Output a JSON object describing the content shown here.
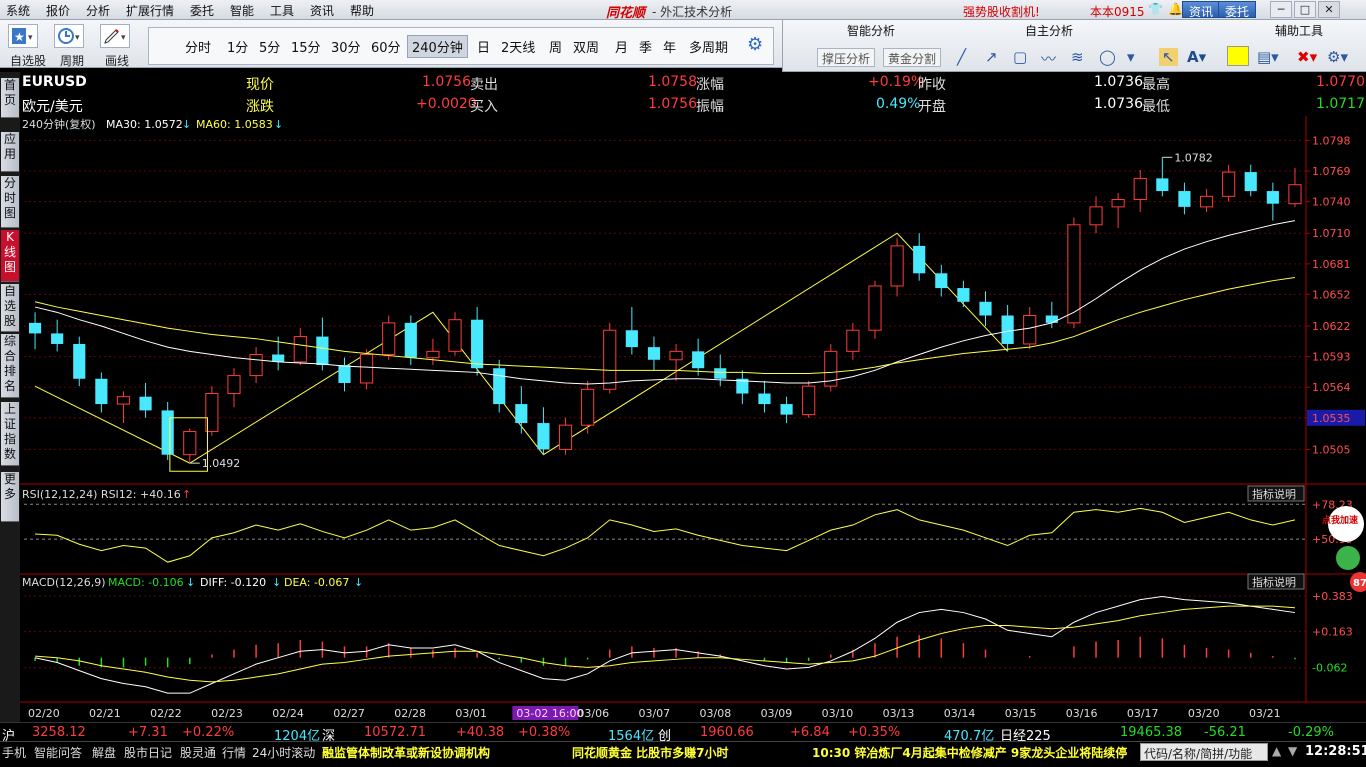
{
  "menu": [
    "系统",
    "报价",
    "分析",
    "扩展行情",
    "委托",
    "智能",
    "工具",
    "资讯",
    "帮助"
  ],
  "logo": "同花顺",
  "app_title": "- 外汇技术分析",
  "notice": "强势股收割机!",
  "user": "本本0915",
  "header_buttons": {
    "news": "资讯",
    "trade": "委托"
  },
  "toolbar": {
    "self_select": "自选股",
    "period": "周期",
    "draw": "画线"
  },
  "periods": [
    "分时",
    "1分",
    "5分",
    "15分",
    "30分",
    "60分",
    "240分钟",
    "日",
    "2天线",
    "周",
    "双周",
    "月",
    "季",
    "年",
    "多周期"
  ],
  "selected_period": "240分钟",
  "panels": {
    "smart": "智能分析",
    "self": "自主分析",
    "aux": "辅助工具",
    "support": "撑压分析",
    "gold": "黄金分割"
  },
  "sidebar": [
    "首页",
    "应用",
    "分时图",
    "K线图",
    "自选股",
    "综合排名",
    "上证指数",
    "更多"
  ],
  "sidebar_selected": "K线图",
  "quote": {
    "symbol": "EURUSD",
    "name": "欧元/美元",
    "price_label": "现价",
    "price": "1.0756",
    "change_label": "涨跌",
    "change": "+0.0020",
    "sell_label": "卖出",
    "sell": "1.0758",
    "buy_label": "买入",
    "buy": "1.0756",
    "pct_label": "涨幅",
    "pct": "+0.19%",
    "amp_label": "振幅",
    "amp": "0.49%",
    "prevclose_label": "昨收",
    "prevclose": "1.0736",
    "open_label": "开盘",
    "open": "1.0736",
    "high_label": "最高",
    "high": "1.0770",
    "low_label": "最低",
    "low": "1.0717"
  },
  "ma_line": {
    "period": "240分钟(复权)",
    "ma30": "MA30: 1.0572",
    "ma60": "MA60: 1.0583"
  },
  "indicators": {
    "rsi": "RSI(12,12,24) RSI12: +40.16",
    "rsi_btn": "指标说明",
    "rsi_ticks": [
      "78.23",
      "50.99"
    ],
    "macd": "MACD(12,26,9)",
    "macd_val": "MACD: -0.106",
    "diff_val": "DIFF: -0.120",
    "dea_val": "DEA: -0.067",
    "macd_btn": "指标说明",
    "macd_ticks": [
      "0.383",
      "0.163",
      "-0.062"
    ],
    "badge": "点我加速",
    "badge_num": "87"
  },
  "chart_data": {
    "type": "candlestick",
    "y_ticks": [
      "1.0798",
      "1.0769",
      "1.0740",
      "1.0710",
      "1.0681",
      "1.0652",
      "1.0622",
      "1.0593",
      "1.0564",
      "1.0535",
      "1.0505"
    ],
    "ylim": [
      1.0476,
      1.0806
    ],
    "current_price_tag": "1.0535",
    "annotations": [
      {
        "text": "1.0782"
      },
      {
        "text": "1.0492"
      }
    ],
    "x_labels": [
      "02/20",
      "02/21",
      "02/22",
      "02/23",
      "02/24",
      "02/27",
      "02/28",
      "03/01",
      "03-02 16:00",
      "03/06",
      "03/07",
      "03/08",
      "03/09",
      "03/10",
      "03/13",
      "03/14",
      "03/15",
      "03/16",
      "03/17",
      "03/20",
      "03/21"
    ],
    "ohlc": [
      [
        1.0625,
        1.0635,
        1.06,
        1.0615
      ],
      [
        1.0615,
        1.0628,
        1.0598,
        1.0605
      ],
      [
        1.0605,
        1.0612,
        1.0565,
        1.0572
      ],
      [
        1.0572,
        1.0578,
        1.054,
        1.0548
      ],
      [
        1.0548,
        1.056,
        1.053,
        1.0555
      ],
      [
        1.0555,
        1.0568,
        1.0535,
        1.0542
      ],
      [
        1.0542,
        1.055,
        1.0495,
        1.05
      ],
      [
        1.05,
        1.0525,
        1.0492,
        1.0522
      ],
      [
        1.0522,
        1.0565,
        1.0518,
        1.0558
      ],
      [
        1.0558,
        1.0582,
        1.0545,
        1.0575
      ],
      [
        1.0575,
        1.0602,
        1.0568,
        1.0595
      ],
      [
        1.0595,
        1.0612,
        1.058,
        1.0588
      ],
      [
        1.0588,
        1.062,
        1.0585,
        1.0612
      ],
      [
        1.0612,
        1.063,
        1.058,
        1.0585
      ],
      [
        1.0585,
        1.0592,
        1.056,
        1.0568
      ],
      [
        1.0568,
        1.06,
        1.0562,
        1.0595
      ],
      [
        1.0595,
        1.0632,
        1.059,
        1.0625
      ],
      [
        1.0625,
        1.0632,
        1.0585,
        1.0592
      ],
      [
        1.0592,
        1.061,
        1.0585,
        1.0598
      ],
      [
        1.0598,
        1.0635,
        1.0594,
        1.0628
      ],
      [
        1.0628,
        1.064,
        1.0575,
        1.0582
      ],
      [
        1.0582,
        1.059,
        1.054,
        1.0548
      ],
      [
        1.0548,
        1.0565,
        1.052,
        1.053
      ],
      [
        1.053,
        1.0545,
        1.05,
        1.0505
      ],
      [
        1.0505,
        1.0535,
        1.05,
        1.0528
      ],
      [
        1.0528,
        1.057,
        1.052,
        1.0562
      ],
      [
        1.0562,
        1.0625,
        1.0558,
        1.0618
      ],
      [
        1.0618,
        1.064,
        1.0595,
        1.0602
      ],
      [
        1.0602,
        1.0612,
        1.058,
        1.059
      ],
      [
        1.059,
        1.0605,
        1.057,
        1.0598
      ],
      [
        1.0598,
        1.061,
        1.0575,
        1.0582
      ],
      [
        1.0582,
        1.0595,
        1.0565,
        1.0572
      ],
      [
        1.0572,
        1.058,
        1.0548,
        1.0558
      ],
      [
        1.0558,
        1.057,
        1.054,
        1.0548
      ],
      [
        1.0548,
        1.0555,
        1.053,
        1.0538
      ],
      [
        1.0538,
        1.057,
        1.0535,
        1.0565
      ],
      [
        1.0565,
        1.0605,
        1.056,
        1.0598
      ],
      [
        1.0598,
        1.0625,
        1.059,
        1.0618
      ],
      [
        1.0618,
        1.0665,
        1.061,
        1.066
      ],
      [
        1.066,
        1.0705,
        1.065,
        1.0698
      ],
      [
        1.0698,
        1.071,
        1.0665,
        1.0672
      ],
      [
        1.0672,
        1.068,
        1.065,
        1.0658
      ],
      [
        1.0658,
        1.0665,
        1.064,
        1.0645
      ],
      [
        1.0645,
        1.0655,
        1.0622,
        1.0632
      ],
      [
        1.0632,
        1.0642,
        1.0598,
        1.0605
      ],
      [
        1.0605,
        1.064,
        1.06,
        1.0632
      ],
      [
        1.0632,
        1.0645,
        1.062,
        1.0625
      ],
      [
        1.0625,
        1.0725,
        1.062,
        1.0718
      ],
      [
        1.0718,
        1.0745,
        1.071,
        1.0735
      ],
      [
        1.0735,
        1.0748,
        1.0715,
        1.0742
      ],
      [
        1.0742,
        1.077,
        1.073,
        1.0762
      ],
      [
        1.0762,
        1.0782,
        1.0745,
        1.075
      ],
      [
        1.075,
        1.0758,
        1.0728,
        1.0735
      ],
      [
        1.0735,
        1.0752,
        1.073,
        1.0745
      ],
      [
        1.0745,
        1.0775,
        1.074,
        1.0768
      ],
      [
        1.0768,
        1.0775,
        1.0745,
        1.075
      ],
      [
        1.075,
        1.0758,
        1.0722,
        1.0738
      ],
      [
        1.0738,
        1.0772,
        1.0735,
        1.0756
      ]
    ],
    "ma30": [
      1.064,
      1.0635,
      1.0628,
      1.0622,
      1.0615,
      1.0608,
      1.0602,
      1.0598,
      1.0595,
      1.0592,
      1.059,
      1.0588,
      1.0587,
      1.0586,
      1.0584,
      1.0583,
      1.0582,
      1.0581,
      1.058,
      1.0579,
      1.0578,
      1.0575,
      1.0572,
      1.057,
      1.0568,
      1.0567,
      1.0568,
      1.057,
      1.0571,
      1.0572,
      1.0572,
      1.0571,
      1.057,
      1.0569,
      1.0568,
      1.0568,
      1.057,
      1.0574,
      1.058,
      1.0588,
      1.0595,
      1.0602,
      1.0608,
      1.0613,
      1.0617,
      1.062,
      1.0625,
      1.0635,
      1.0648,
      1.0662,
      1.0675,
      1.0686,
      1.0695,
      1.0702,
      1.0708,
      1.0713,
      1.0718,
      1.0722
    ],
    "ma60": [
      1.0645,
      1.064,
      1.0636,
      1.0632,
      1.0628,
      1.0624,
      1.062,
      1.0617,
      1.0614,
      1.0612,
      1.061,
      1.0607,
      1.0604,
      1.0601,
      1.0598,
      1.0596,
      1.0594,
      1.0592,
      1.059,
      1.0588,
      1.0586,
      1.0585,
      1.0584,
      1.0583,
      1.0582,
      1.0581,
      1.058,
      1.058,
      1.058,
      1.058,
      1.0579,
      1.0578,
      1.0578,
      1.0577,
      1.0577,
      1.0577,
      1.0578,
      1.058,
      1.0583,
      1.0587,
      1.059,
      1.0593,
      1.0596,
      1.0598,
      1.06,
      1.0602,
      1.0606,
      1.0612,
      1.062,
      1.0628,
      1.0635,
      1.0641,
      1.0647,
      1.0652,
      1.0657,
      1.0661,
      1.0665,
      1.0668
    ],
    "zigzag": [
      [
        0,
        1.0565
      ],
      [
        7,
        1.0492
      ],
      [
        18,
        1.0635
      ],
      [
        23,
        1.05
      ],
      [
        39,
        1.071
      ],
      [
        44,
        1.0598
      ]
    ],
    "rsi": [
      55,
      54,
      47,
      42,
      46,
      44,
      33,
      38,
      52,
      56,
      62,
      58,
      63,
      57,
      52,
      58,
      66,
      58,
      60,
      66,
      56,
      46,
      42,
      38,
      44,
      52,
      66,
      62,
      57,
      59,
      54,
      50,
      46,
      44,
      42,
      50,
      58,
      62,
      70,
      74,
      66,
      62,
      58,
      52,
      46,
      54,
      56,
      72,
      74,
      72,
      75,
      72,
      64,
      68,
      72,
      66,
      62,
      66
    ],
    "macd_hist": [
      -0.02,
      -0.03,
      -0.05,
      -0.06,
      -0.06,
      -0.05,
      -0.06,
      -0.04,
      0.02,
      0.05,
      0.08,
      0.09,
      0.11,
      0.1,
      0.07,
      0.07,
      0.09,
      0.06,
      0.05,
      0.06,
      0.03,
      -0.01,
      -0.03,
      -0.05,
      -0.05,
      -0.01,
      0.05,
      0.07,
      0.06,
      0.06,
      0.04,
      0.02,
      0.0,
      -0.02,
      -0.03,
      -0.02,
      0.02,
      0.05,
      0.09,
      0.13,
      0.14,
      0.12,
      0.09,
      0.05,
      0.0,
      0.01,
      0.0,
      0.07,
      0.1,
      0.11,
      0.13,
      0.12,
      0.08,
      0.06,
      0.05,
      0.03,
      0.01,
      -0.01
    ],
    "macd_diff": [
      0.0,
      -0.03,
      -0.08,
      -0.13,
      -0.16,
      -0.18,
      -0.22,
      -0.22,
      -0.16,
      -0.1,
      -0.04,
      0.0,
      0.04,
      0.05,
      0.03,
      0.04,
      0.08,
      0.06,
      0.06,
      0.08,
      0.04,
      -0.03,
      -0.08,
      -0.13,
      -0.14,
      -0.1,
      -0.02,
      0.03,
      0.04,
      0.05,
      0.03,
      0.01,
      -0.02,
      -0.05,
      -0.07,
      -0.06,
      -0.02,
      0.04,
      0.12,
      0.22,
      0.28,
      0.3,
      0.28,
      0.24,
      0.17,
      0.15,
      0.13,
      0.22,
      0.28,
      0.32,
      0.36,
      0.38,
      0.36,
      0.35,
      0.34,
      0.32,
      0.3,
      0.28
    ],
    "macd_dea": [
      0.01,
      0.0,
      -0.02,
      -0.05,
      -0.07,
      -0.09,
      -0.12,
      -0.14,
      -0.15,
      -0.14,
      -0.12,
      -0.1,
      -0.07,
      -0.04,
      -0.03,
      -0.01,
      0.01,
      0.02,
      0.03,
      0.04,
      0.04,
      0.02,
      0.0,
      -0.03,
      -0.05,
      -0.06,
      -0.05,
      -0.03,
      -0.02,
      -0.01,
      0.0,
      0.0,
      -0.01,
      -0.02,
      -0.03,
      -0.04,
      -0.03,
      -0.02,
      0.01,
      0.06,
      0.11,
      0.15,
      0.18,
      0.2,
      0.2,
      0.19,
      0.18,
      0.19,
      0.21,
      0.23,
      0.26,
      0.28,
      0.3,
      0.31,
      0.32,
      0.32,
      0.32,
      0.31
    ]
  },
  "status": {
    "sh": "沪",
    "sh_val": "3258.12",
    "sh_chg": "+7.31",
    "sh_pct": "+0.22%",
    "sh_amt": "1204亿",
    "sz": "深",
    "sz_val": "10572.71",
    "sz_chg": "+40.38",
    "sz_pct": "+0.38%",
    "sz_amt": "1564亿",
    "cy": "创",
    "cy_val": "1960.66",
    "cy_chg": "+6.84",
    "cy_pct": "+0.35%",
    "cy_amt": "470.7亿",
    "nk": "日经225",
    "nk_val": "19465.38",
    "nk_chg": "-56.21",
    "nk_pct": "-0.29%"
  },
  "bottom": {
    "tabs": [
      "手机",
      "智能问答",
      "解盘",
      "股市日记",
      "股灵通",
      "行情",
      "24小时滚动"
    ],
    "news1": "融监管体制改革或新设协调机构",
    "news2": "同花顺黄金 比股市多赚7小时",
    "news3": "10:30 锌冶炼厂4月起集中检修减产 9家龙头企业将陆续停",
    "search": "代码/名称/简拼/功能",
    "clock": "12:28:51"
  }
}
